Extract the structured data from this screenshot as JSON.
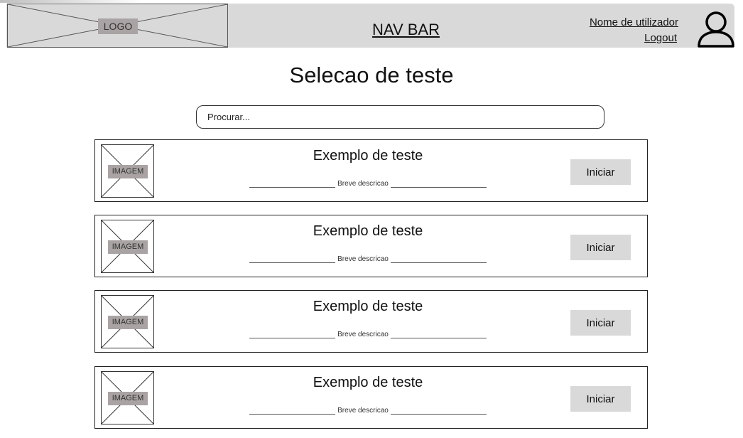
{
  "navbar": {
    "logo_label": "LOGO",
    "title": "NAV BAR",
    "user_name": "Nome de utilizador",
    "logout_label": "Logout",
    "user_icon": "user-icon"
  },
  "page": {
    "title": "Selecao de teste"
  },
  "search": {
    "placeholder": "Procurar...",
    "value": ""
  },
  "tests": [
    {
      "image_label": "IMAGEM",
      "title": "Exemplo de teste",
      "description": "Breve descricao",
      "button_label": "Iniciar"
    },
    {
      "image_label": "IMAGEM",
      "title": "Exemplo de teste",
      "description": "Breve descricao",
      "button_label": "Iniciar"
    },
    {
      "image_label": "IMAGEM",
      "title": "Exemplo de teste",
      "description": "Breve descricao",
      "button_label": "Iniciar"
    },
    {
      "image_label": "IMAGEM",
      "title": "Exemplo de teste",
      "description": "Breve descricao",
      "button_label": "Iniciar"
    }
  ],
  "colors": {
    "navbar_bg": "#d9d9d9",
    "placeholder_label_bg": "#a9a3a3",
    "button_bg": "#d9d9d9"
  }
}
